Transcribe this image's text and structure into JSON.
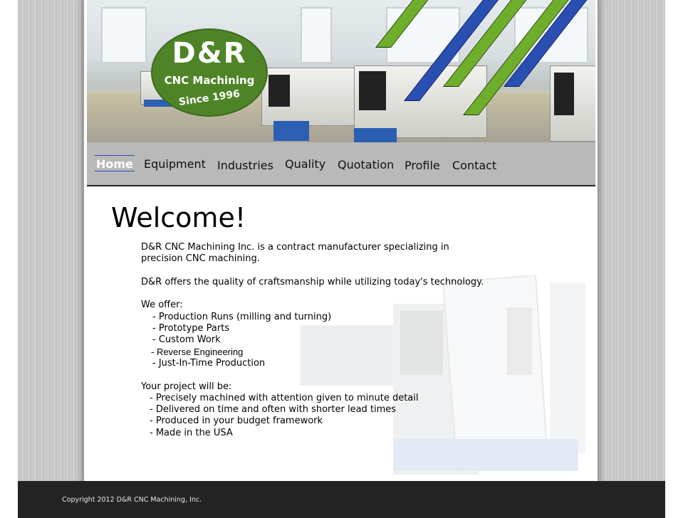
{
  "logo": {
    "brand": "D&R",
    "name": "CNC Machining",
    "since": "Since 1996"
  },
  "nav": {
    "items": [
      {
        "label": "Home",
        "active": true
      },
      {
        "label": "Equipment",
        "active": false
      },
      {
        "label": "Industries",
        "active": false
      },
      {
        "label": "Quality",
        "active": false
      },
      {
        "label": "Quotation",
        "active": false
      },
      {
        "label": "Profile",
        "active": false
      },
      {
        "label": "Contact",
        "active": false
      }
    ]
  },
  "main": {
    "heading": "Welcome!",
    "intro_line1": "D&R CNC Machining Inc. is a contract manufacturer specializing in",
    "intro_line2": "precision CNC machining.",
    "quality_line": "D&R offers the quality of craftsmanship while utilizing today's technology.",
    "offer_heading": "We offer:",
    "offers": [
      "- Production Runs (milling and turning)",
      "- Prototype Parts",
      "- Custom Work",
      "- Reverse Engineering",
      "- Just-In-Time Production"
    ],
    "project_heading": "Your project will be:",
    "project_points": [
      "- Precisely machined with attention given to minute detail",
      "- Delivered on time and often with shorter lead times",
      "- Produced in your budget framework",
      "- Made in the USA"
    ]
  },
  "footer": {
    "copyright": "Copyright 2012 D&R CNC Machining, Inc."
  },
  "colors": {
    "logo_green": "#4e8427",
    "stripe_green": "#6fae2a",
    "stripe_blue": "#2a4fb3",
    "nav_bg": "#b9b9b9",
    "footer_bg": "#232323"
  }
}
